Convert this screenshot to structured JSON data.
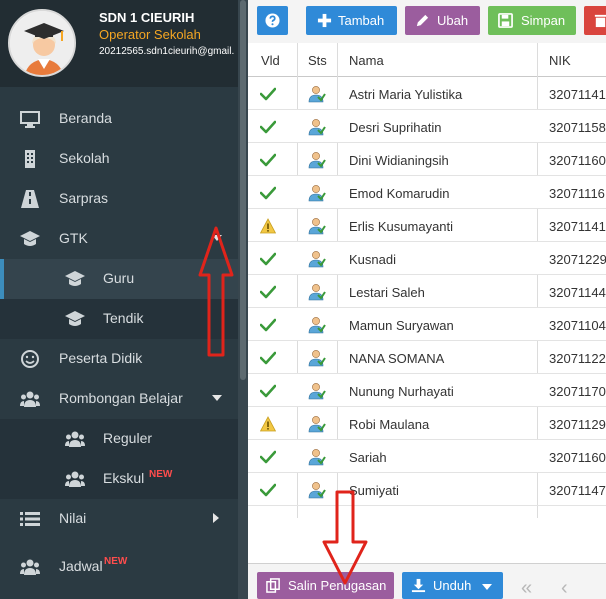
{
  "profile": {
    "school_name": "SDN 1 CIEURIH",
    "role": "Operator Sekolah",
    "email": "20212565.sdn1cieurih@gmail."
  },
  "sidebar": {
    "items": [
      {
        "label": "Beranda",
        "icon": "monitor-icon"
      },
      {
        "label": "Sekolah",
        "icon": "building-icon"
      },
      {
        "label": "Sarpras",
        "icon": "road-icon"
      },
      {
        "label": "GTK",
        "icon": "graduation-cap-icon"
      },
      {
        "label": "Guru",
        "icon": "graduation-cap-icon"
      },
      {
        "label": "Tendik",
        "icon": "graduation-cap-icon"
      },
      {
        "label": "Peserta Didik",
        "icon": "smile-icon"
      },
      {
        "label": "Rombongan Belajar",
        "icon": "users-icon"
      },
      {
        "label": "Reguler",
        "icon": "users-icon"
      },
      {
        "label": "Ekskul",
        "icon": "users-icon",
        "badge": "NEW"
      },
      {
        "label": "Nilai",
        "icon": "list-icon"
      },
      {
        "label": "Jadwal",
        "icon": "users-icon",
        "badge": "NEW"
      }
    ]
  },
  "toolbar": {
    "tambah_label": "Tambah",
    "ubah_label": "Ubah",
    "simpan_label": "Simpan"
  },
  "table": {
    "columns": [
      "Vld",
      "Sts",
      "Nama",
      "NIK"
    ],
    "rows": [
      {
        "vld": "check",
        "nama": "Astri Maria Yulistika",
        "nik": "32071141"
      },
      {
        "vld": "check",
        "nama": "Desri Suprihatin",
        "nik": "32071158"
      },
      {
        "vld": "check",
        "nama": "Dini Widianingsih",
        "nik": "32071160"
      },
      {
        "vld": "check",
        "nama": "Emod Komarudin",
        "nik": "32071116"
      },
      {
        "vld": "warning",
        "nama": "Erlis Kusumayanti",
        "nik": "32071141"
      },
      {
        "vld": "check",
        "nama": "Kusnadi",
        "nik": "32071229"
      },
      {
        "vld": "check",
        "nama": "Lestari Saleh",
        "nik": "32071144"
      },
      {
        "vld": "check",
        "nama": "Mamun Suryawan",
        "nik": "32071104"
      },
      {
        "vld": "check",
        "nama": "NANA SOMANA",
        "nik": "32071122"
      },
      {
        "vld": "check",
        "nama": "Nunung Nurhayati",
        "nik": "32071170"
      },
      {
        "vld": "warning",
        "nama": "Robi Maulana",
        "nik": "32071129"
      },
      {
        "vld": "check",
        "nama": "Sariah",
        "nik": "32071160"
      },
      {
        "vld": "check",
        "nama": "Sumiyati",
        "nik": "32071147"
      }
    ]
  },
  "bottombar": {
    "salin_label": "Salin Penugasan",
    "unduh_label": "Unduh"
  },
  "colors": {
    "help": "#2f8ad8",
    "tambah": "#2f8ad8",
    "ubah": "#9b5d9e",
    "simpan": "#6fbf5a",
    "hapus": "#d9453e",
    "salin": "#9b5d9e",
    "unduh": "#2f8ad8",
    "accent_orange": "#f5a623",
    "annotation_red": "#e0241b"
  }
}
